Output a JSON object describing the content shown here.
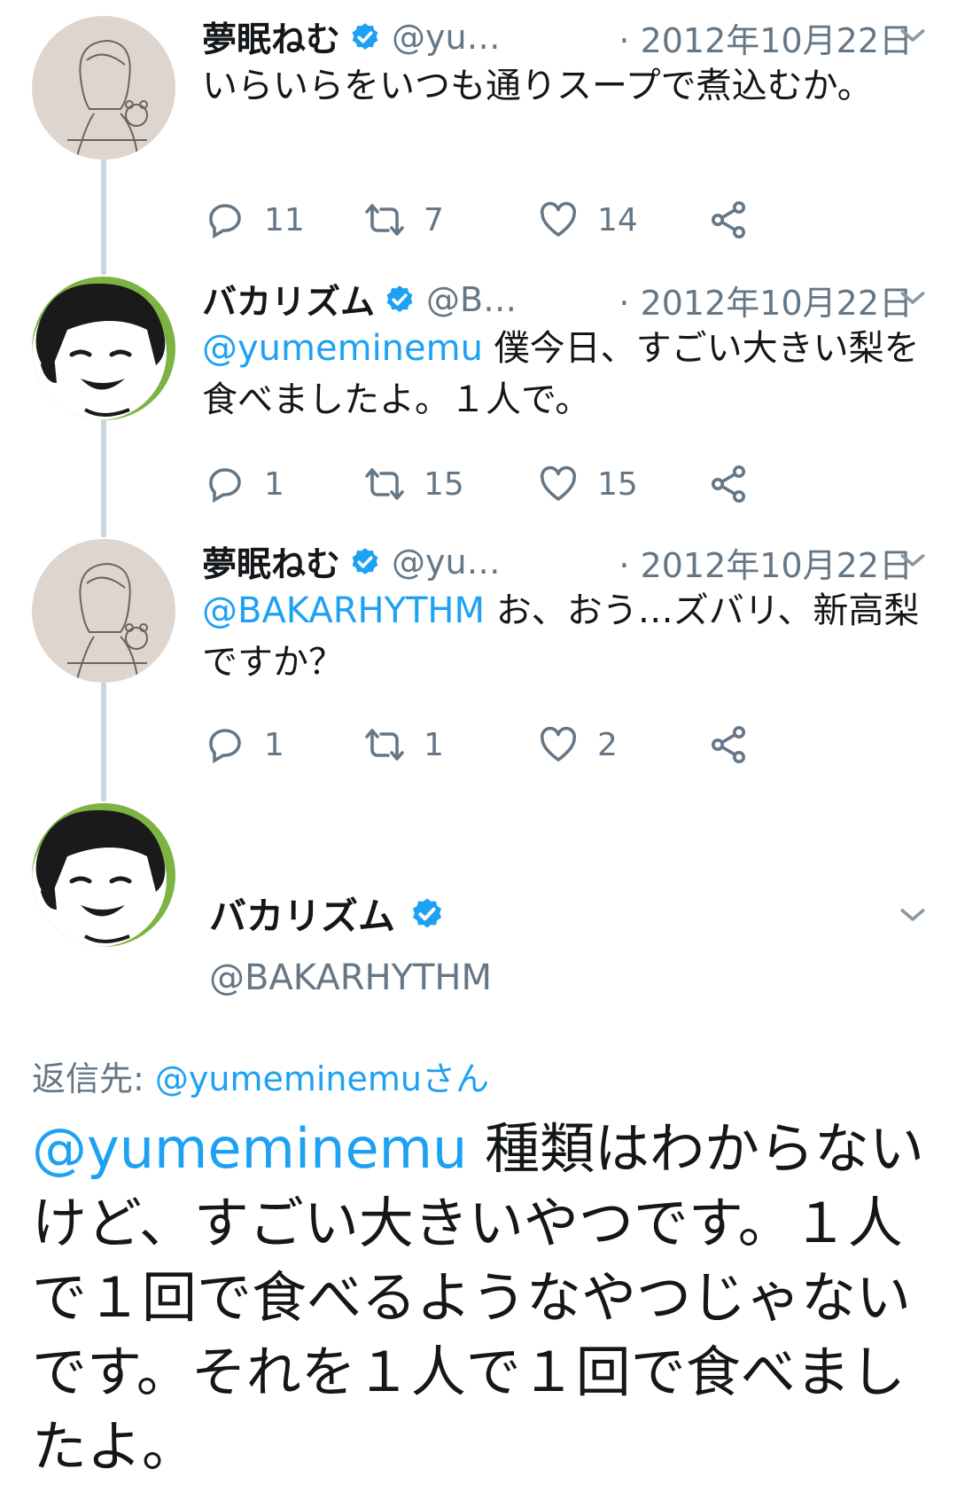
{
  "tweets": [
    {
      "name": "夢眠ねむ",
      "handle": "@yu…",
      "date": "· 2012年10月22日",
      "mention": "",
      "text": "いらいらをいつも通りスープで煮込むか。",
      "replies": "11",
      "retweets": "7",
      "likes": "14"
    },
    {
      "name": "バカリズム",
      "handle": "@B…",
      "date": "· 2012年10月22日",
      "mention": "@yumeminemu",
      "text": " 僕今日、すごい大きい梨を食べましたよ。１人で。",
      "replies": "1",
      "retweets": "15",
      "likes": "15"
    },
    {
      "name": "夢眠ねむ",
      "handle": "@yu…",
      "date": "· 2012年10月22日",
      "mention": "@BAKARHYTHM",
      "text": " お、おう…ズバリ、新高梨ですか？",
      "replies": "1",
      "retweets": "1",
      "likes": "2"
    }
  ],
  "main_tweet": {
    "name": "バカリズム",
    "handle": "@BAKARHYTHM",
    "reply_label": "返信先: ",
    "reply_to": "@yumeminemuさん",
    "mention": "@yumeminemu",
    "text": " 種類はわからないけど、すごい大きいやつです。１人で１回で食べるようなやつじゃないです。それを１人で１回で食べましたよ。"
  },
  "colors": {
    "accent": "#1da1f2",
    "text_secondary": "#657786",
    "thread_line": "#ccd6dd"
  },
  "icons": [
    "verified-icon",
    "caret-down-icon",
    "reply-icon",
    "retweet-icon",
    "like-icon",
    "share-icon"
  ]
}
